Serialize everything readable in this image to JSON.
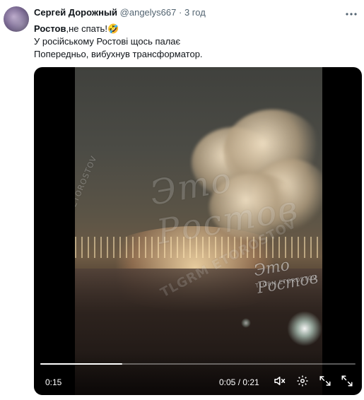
{
  "tweet": {
    "author_name": "Сергей Дорожный",
    "handle": "@angelys667",
    "separator": "·",
    "time": "3 год",
    "text_line1_bold": "Ростов",
    "text_line1_rest": ",не спать!",
    "text_line1_emoji": "🤣",
    "text_line2": "У російському Ростові щось палає",
    "text_line3": "Попередньо, вибухнув трансформатор."
  },
  "video": {
    "watermark_main": "Это Ростов",
    "watermark_side": "VK.COM/ETOROSTOV",
    "watermark_tg": "TLGRM ETOROSTOV",
    "watermark_small": "Это Ростов",
    "watermark_sub": "TLGRM ETOROSTOV",
    "current_time_left": "0:15",
    "time_readout": "0:05 / 0:21",
    "progress_fraction": 0.26
  },
  "icons": {
    "more": "more-icon",
    "mute": "speaker-muted-icon",
    "settings": "gear-icon",
    "pip": "picture-in-picture-icon",
    "fullscreen": "fullscreen-icon"
  }
}
